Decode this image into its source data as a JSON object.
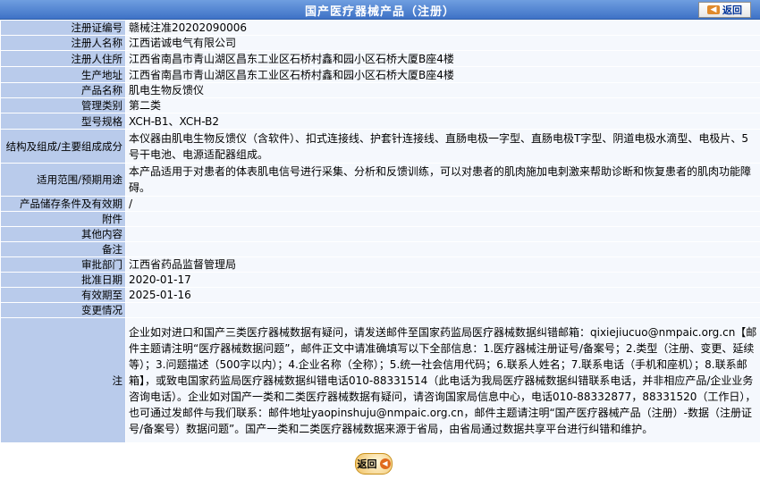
{
  "header": {
    "title": "国产医疗器械产品（注册）",
    "back_label": "返回"
  },
  "rows": [
    {
      "label": "注册证编号",
      "value": "赣械注准20202090006"
    },
    {
      "label": "注册人名称",
      "value": "江西诺诚电气有限公司"
    },
    {
      "label": "注册人住所",
      "value": "江西省南昌市青山湖区昌东工业区石桥村鑫和园小区石桥大厦B座4楼"
    },
    {
      "label": "生产地址",
      "value": "江西省南昌市青山湖区昌东工业区石桥村鑫和园小区石桥大厦B座4楼"
    },
    {
      "label": "产品名称",
      "value": "肌电生物反馈仪"
    },
    {
      "label": "管理类别",
      "value": "第二类"
    },
    {
      "label": "型号规格",
      "value": "XCH-B1、XCH-B2"
    },
    {
      "label": "结构及组成/主要组成成分",
      "value": "本仪器由肌电生物反馈仪（含软件）、扣式连接线、护套针连接线、直肠电极一字型、直肠电极T字型、阴道电极水滴型、电极片、5号干电池、电源适配器组成。"
    },
    {
      "label": "适用范围/预期用途",
      "value": "本产品适用于对患者的体表肌电信号进行采集、分析和反馈训练，可以对患者的肌肉施加电刺激来帮助诊断和恢复患者的肌肉功能障碍。"
    },
    {
      "label": "产品储存条件及有效期",
      "value": "/"
    },
    {
      "label": "附件",
      "value": ""
    },
    {
      "label": "其他内容",
      "value": ""
    },
    {
      "label": "备注",
      "value": ""
    },
    {
      "label": "审批部门",
      "value": "江西省药品监督管理局"
    },
    {
      "label": "批准日期",
      "value": "2020-01-17"
    },
    {
      "label": "有效期至",
      "value": "2025-01-16"
    },
    {
      "label": "变更情况",
      "value": ""
    },
    {
      "label": "注",
      "value": "企业如对进口和国产三类医疗器械数据有疑问，请发送邮件至国家药监局医疗器械数据纠错邮箱：qixiejiucuo@nmpaic.org.cn【邮件主题请注明“医疗器械数据问题”，邮件正文中请准确填写以下全部信息：1.医疗器械注册证号/备案号；2.类型（注册、变更、延续等）；3.问题描述（500字以内）；4.企业名称（全称）；5.统一社会信用代码；6.联系人姓名；7.联系电话（手机和座机）；8.联系邮箱】，或致电国家药监局医疗器械数据纠错电话010-88331514（此电话为我局医疗器械数据纠错联系电话，并非相应产品/企业业务咨询电话）。企业如对国产一类和二类医疗器械数据有疑问，请咨询国家局信息中心，电话010-88332877，88331520（工作日），也可通过发邮件与我们联系：邮件地址yaopinshuju@nmpaic.org.cn，邮件主题请注明“国产医疗器械产品（注册）-数据（注册证号/备案号）数据问题”。国产一类和二类医疗器械数据来源于省局，由省局通过数据共享平台进行纠错和维护。"
    }
  ],
  "footer": {
    "back_label": "返回"
  }
}
